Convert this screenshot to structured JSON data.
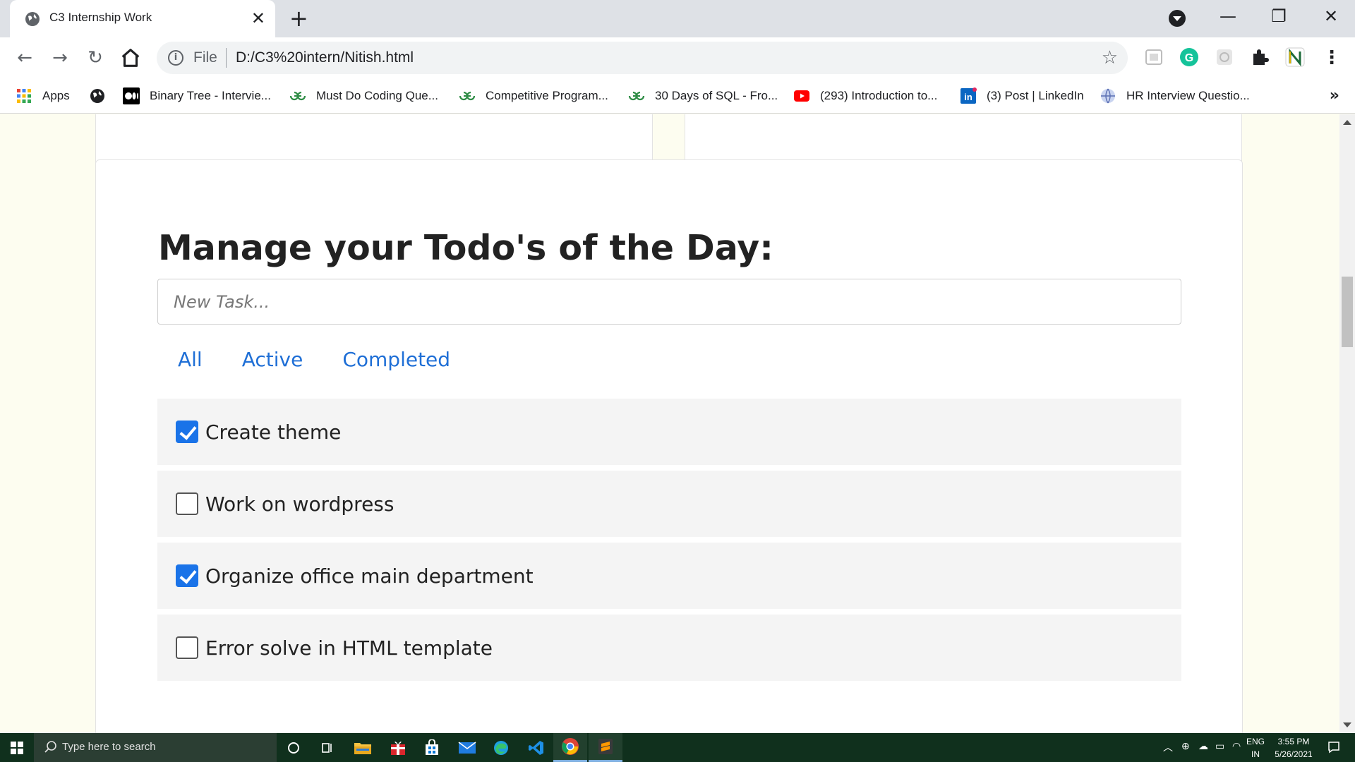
{
  "browser": {
    "tab_title": "C3 Internship Work",
    "tab_close": "✕",
    "new_tab": "+",
    "url_scheme": "File",
    "url": "D:/C3%20intern/Nitish.html"
  },
  "bookmarks": [
    {
      "label": "Apps",
      "icon": "apps-grid-icon"
    },
    {
      "label": "",
      "icon": "globe-icon"
    },
    {
      "label": "Binary Tree - Intervie...",
      "icon": "medium-icon"
    },
    {
      "label": "Must Do Coding Que...",
      "icon": "geeksforgeeks-icon"
    },
    {
      "label": "Competitive Program...",
      "icon": "geeksforgeeks-icon"
    },
    {
      "label": "30 Days of SQL - Fro...",
      "icon": "geeksforgeeks-icon"
    },
    {
      "label": "(293) Introduction to...",
      "icon": "youtube-icon"
    },
    {
      "label": "(3) Post | LinkedIn",
      "icon": "linkedin-icon"
    },
    {
      "label": "HR Interview Questio...",
      "icon": "globe-icon"
    }
  ],
  "bookmarks_more": "»",
  "todo_app": {
    "heading": "Manage your Todo's of the Day:",
    "input_placeholder": "New Task...",
    "filters": [
      "All",
      "Active",
      "Completed"
    ],
    "tasks": [
      {
        "text": "Create theme",
        "done": true
      },
      {
        "text": "Work on wordpress",
        "done": false
      },
      {
        "text": "Organize office main department",
        "done": true
      },
      {
        "text": "Error solve in HTML template",
        "done": false
      }
    ]
  },
  "taskbar": {
    "search_placeholder": "Type here to search",
    "lang_line1": "ENG",
    "lang_line2": "IN",
    "time": "3:55 PM",
    "date": "5/26/2021"
  },
  "colors": {
    "page_bg": "#fdfdf0",
    "link_blue": "#1f6fd6",
    "check_blue": "#1a73e8",
    "taskbar": "#10301d"
  }
}
